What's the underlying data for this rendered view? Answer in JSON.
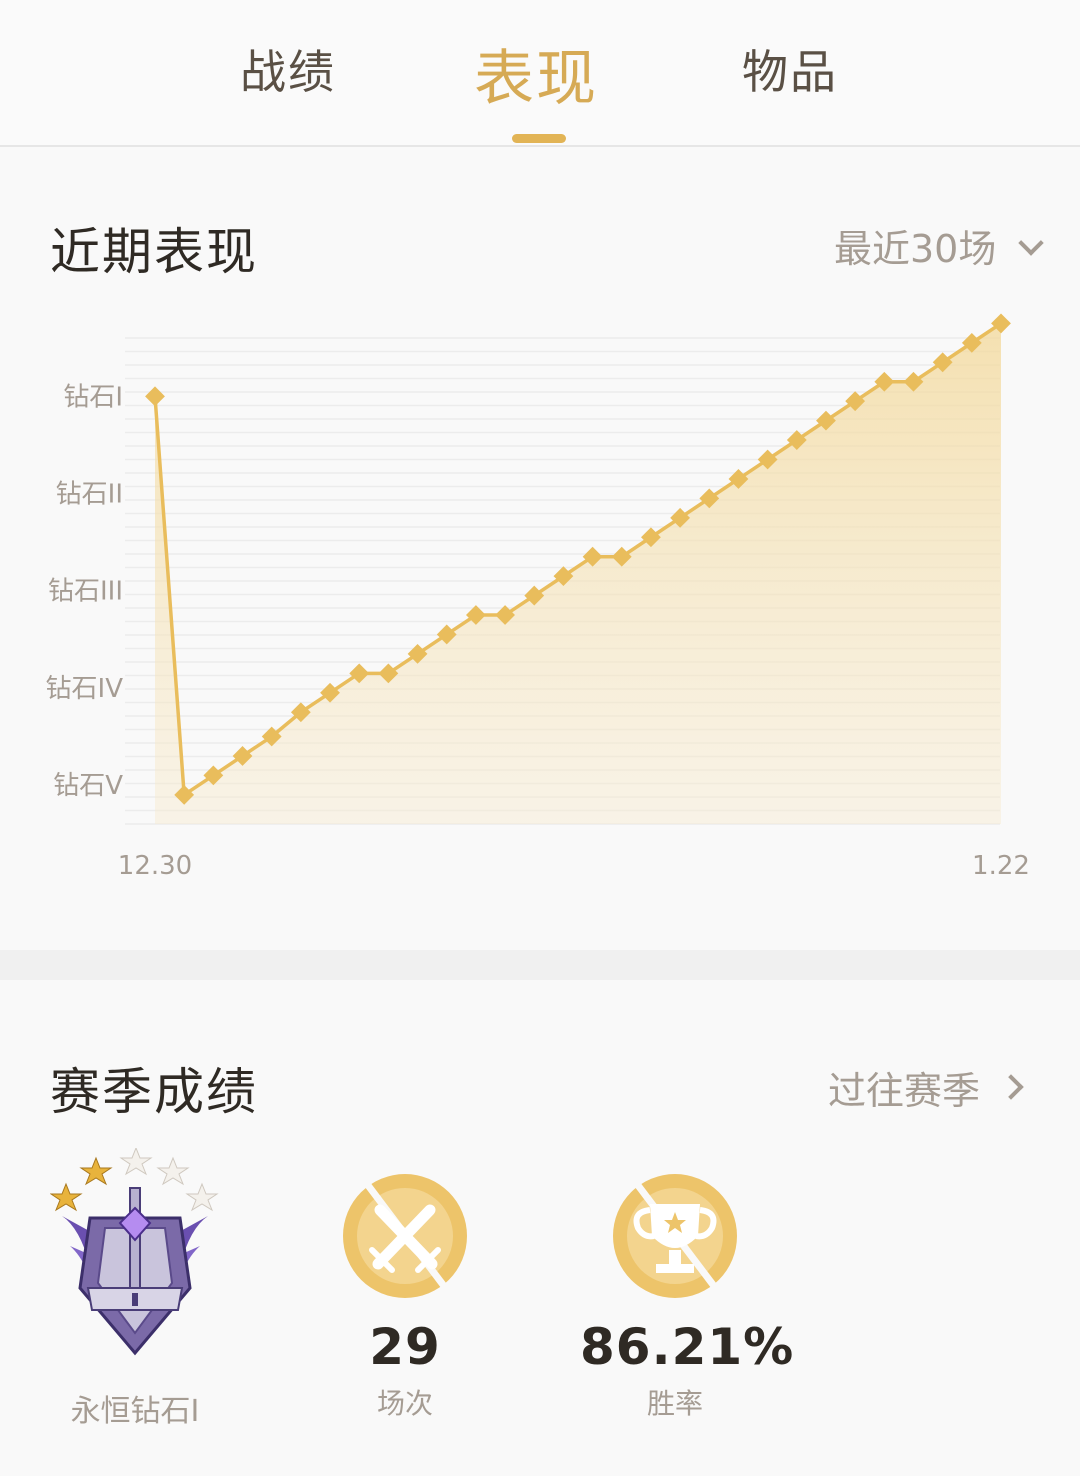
{
  "tabs": [
    {
      "label": "战绩",
      "active": false
    },
    {
      "label": "表现",
      "active": true
    },
    {
      "label": "物品",
      "active": false
    }
  ],
  "recent": {
    "title": "近期表现",
    "filter_label": "最近30场"
  },
  "season": {
    "title": "赛季成绩",
    "past_label": "过往赛季",
    "rank_name": "永恒钻石I",
    "games_value": "29",
    "games_label": "场次",
    "winrate_value": "86.21%",
    "winrate_label": "胜率"
  },
  "colors": {
    "accent": "#e2b455",
    "line": "#e9bd5c",
    "text_dark": "#2f2a24",
    "text_muted": "#a59c93"
  },
  "icons": {
    "rank_badge": "diamond-rank-badge-icon",
    "games": "crossed-swords-icon",
    "winrate": "trophy-icon"
  },
  "chart_data": {
    "type": "line",
    "y_tick_labels": [
      "钻石I",
      "钻石II",
      "钻石III",
      "钻石IV",
      "钻石V"
    ],
    "y_tick_values": [
      4,
      3,
      2,
      1,
      0
    ],
    "x_tick_labels": [
      "12.30",
      "1.22"
    ],
    "ylim": [
      -0.4,
      4.6
    ],
    "grid": true,
    "area_fill": true,
    "values": [
      4.0,
      -0.1,
      0.1,
      0.3,
      0.5,
      0.75,
      0.95,
      1.15,
      1.15,
      1.35,
      1.55,
      1.75,
      1.75,
      1.95,
      2.15,
      2.35,
      2.35,
      2.55,
      2.75,
      2.95,
      3.15,
      3.35,
      3.55,
      3.75,
      3.95,
      4.15,
      4.15,
      4.35,
      4.55,
      4.75
    ]
  }
}
